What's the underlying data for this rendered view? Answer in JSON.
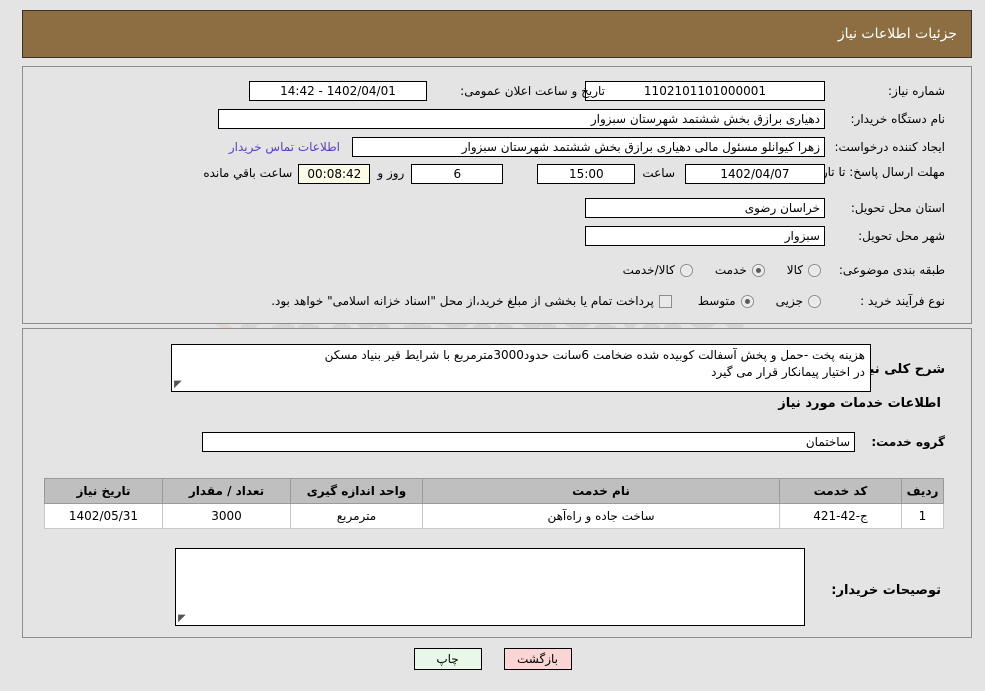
{
  "window": {
    "title": "جزئیات اطلاعات نیاز",
    "header_bg": "#8c6e42"
  },
  "watermark": {
    "text": "AriaTender.net",
    "shield_icon": "shield-icon"
  },
  "form": {
    "need_number": {
      "label": "شماره نیاز:",
      "value": "1102101101000001"
    },
    "announce_datetime": {
      "label": "تاریخ و ساعت اعلان عمومی:",
      "value": "1402/04/01 - 14:42"
    },
    "buyer_org": {
      "label": "نام دستگاه خریدار:",
      "value": "دهیاری برازق بخش ششتمد شهرستان سبزوار"
    },
    "requester": {
      "label": "ایجاد کننده درخواست:",
      "value": "زهرا کیوانلو مسئول مالی دهیاری برازق بخش ششتمد شهرستان سبزوار"
    },
    "buyer_contact_link": "اطلاعات تماس خریدار",
    "deadline": {
      "label": "مهلت ارسال پاسخ: تا تاریخ:",
      "date": "1402/04/07",
      "time_label": "ساعت",
      "time": "15:00",
      "days": "6",
      "days_label": "روز و",
      "countdown": "00:08:42",
      "countdown_label": "ساعت باقي مانده"
    },
    "province": {
      "label": "استان محل تحویل:",
      "value": "خراسان رضوی"
    },
    "city": {
      "label": "شهر محل تحویل:",
      "value": "سبزوار"
    },
    "category": {
      "label": "طبقه بندی موضوعی:",
      "options": [
        {
          "label": "کالا",
          "selected": false
        },
        {
          "label": "خدمت",
          "selected": true
        },
        {
          "label": "کالا/خدمت",
          "selected": false
        }
      ]
    },
    "process_type": {
      "label": "نوع فرآیند خرید :",
      "options": [
        {
          "label": "جزیی",
          "selected": false
        },
        {
          "label": "متوسط",
          "selected": true
        }
      ]
    },
    "treasury_checkbox": {
      "checked": false,
      "label": "پرداخت تمام یا بخشی از مبلغ خرید،از محل \"اسناد خزانه اسلامی\" خواهد بود."
    }
  },
  "description": {
    "label": "شرح کلی نیاز:",
    "line1": "هزینه پخت -حمل و پخش آسفالت کوبیده شده ضخامت 6سانت حدود3000مترمربع با شرایط قیر بنیاد مسکن",
    "line2": "در اختیار پیمانکار قرار می گیرد"
  },
  "services_section": {
    "heading": "اطلاعات خدمات مورد نیاز",
    "service_group": {
      "label": "گروه خدمت:",
      "value": "ساختمان"
    },
    "table": {
      "columns": [
        "ردیف",
        "کد خدمت",
        "نام خدمت",
        "واحد اندازه گیری",
        "تعداد / مقدار",
        "تاریخ نیاز"
      ],
      "rows": [
        {
          "row_no": "1",
          "service_code": "ج-42-421",
          "service_name": "ساخت جاده و راه‌آهن",
          "unit": "مترمربع",
          "quantity": "3000",
          "need_date": "1402/05/31"
        }
      ]
    }
  },
  "buyer_notes": {
    "label": "توصیحات خریدار:",
    "value": ""
  },
  "buttons": {
    "print": "چاپ",
    "back": "بازگشت"
  }
}
